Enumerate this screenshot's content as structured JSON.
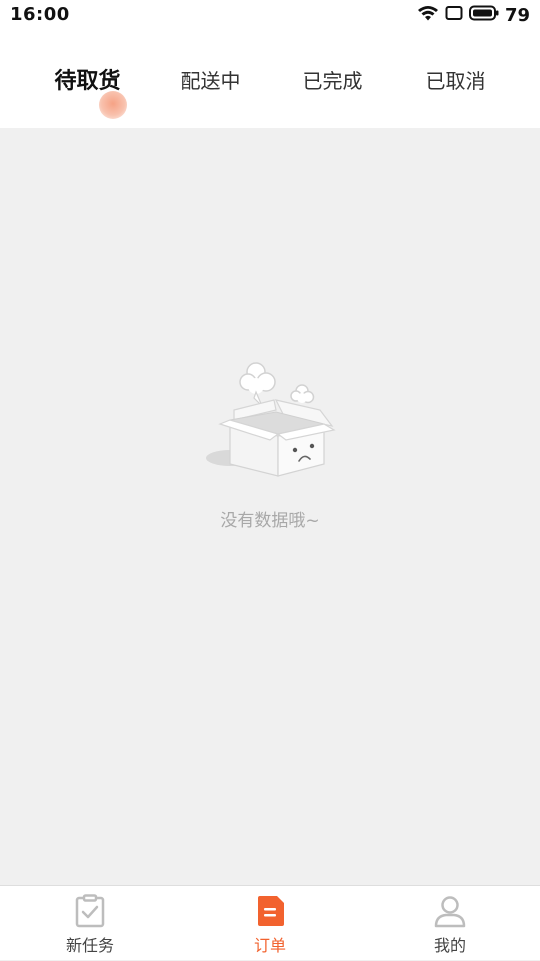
{
  "status_bar": {
    "time": "16:00",
    "battery": "79",
    "icons": [
      "wifi-icon",
      "screen-rotate-icon",
      "battery-icon"
    ]
  },
  "tabs": [
    {
      "label": "待取货",
      "active": true
    },
    {
      "label": "配送中",
      "active": false
    },
    {
      "label": "已完成",
      "active": false
    },
    {
      "label": "已取消",
      "active": false
    }
  ],
  "empty_state": {
    "message": "没有数据哦~",
    "icon": "empty-box-icon"
  },
  "bottom_nav": [
    {
      "label": "新任务",
      "icon": "clipboard-check-icon",
      "active": false
    },
    {
      "label": "订单",
      "icon": "order-document-icon",
      "active": true
    },
    {
      "label": "我的",
      "icon": "user-profile-icon",
      "active": false
    }
  ],
  "colors": {
    "accent": "#f2622e",
    "background": "#f0f0f0",
    "muted_text": "#a8a8a8"
  }
}
